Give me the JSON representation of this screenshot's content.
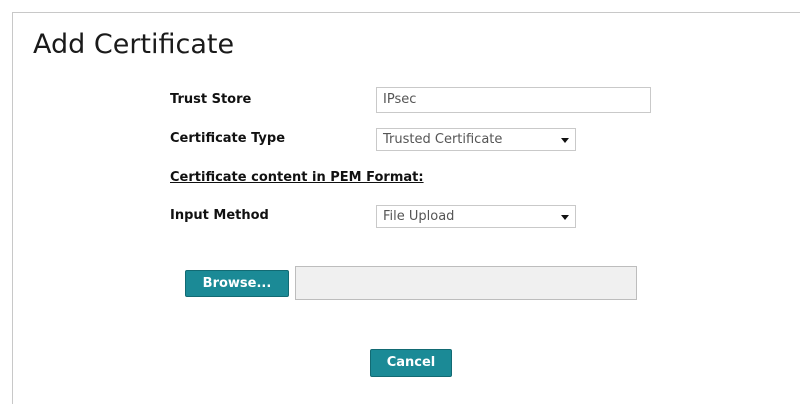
{
  "page": {
    "title": "Add Certificate"
  },
  "form": {
    "trust_store": {
      "label": "Trust Store",
      "value": "IPsec"
    },
    "certificate_type": {
      "label": "Certificate Type",
      "selected": "Trusted Certificate"
    },
    "pem_heading": "Certificate content in PEM Format:",
    "input_method": {
      "label": "Input Method",
      "selected": "File Upload"
    },
    "browse_button": "Browse...",
    "file_path": ""
  },
  "actions": {
    "cancel_label": "Cancel"
  },
  "colors": {
    "button": "#1b8a96",
    "text": "#111111",
    "border": "#c9c9c9"
  },
  "icons": {
    "dropdown": "chevron-down-icon"
  }
}
